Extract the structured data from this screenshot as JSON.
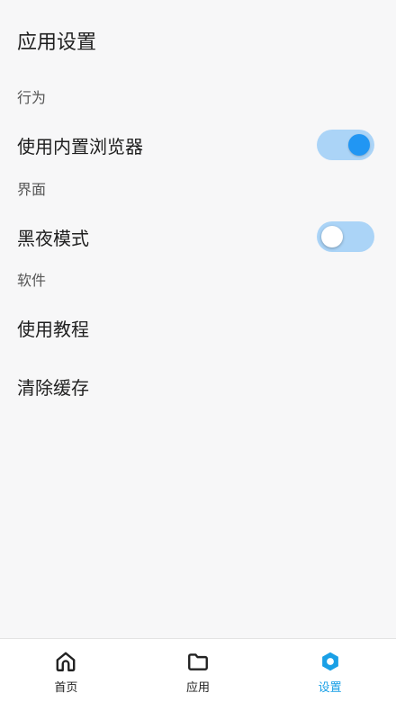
{
  "page": {
    "title": "应用设置"
  },
  "sections": [
    {
      "label": "行为",
      "items": [
        {
          "label": "使用内置浏览器",
          "control": "switch",
          "checked": true
        }
      ]
    },
    {
      "label": "界面",
      "items": [
        {
          "label": "黑夜模式",
          "control": "switch",
          "checked": false
        }
      ]
    },
    {
      "label": "软件",
      "items": [
        {
          "label": "使用教程"
        },
        {
          "label": "清除缓存"
        }
      ]
    }
  ],
  "bottom_nav": {
    "items": [
      {
        "label": "首页",
        "icon": "home-icon",
        "active": false
      },
      {
        "label": "应用",
        "icon": "folder-icon",
        "active": false
      },
      {
        "label": "设置",
        "icon": "gear-icon",
        "active": true
      }
    ]
  },
  "colors": {
    "accent": "#2196f3",
    "switch_track": "#abd4f7",
    "active_nav": "#1aa0e6",
    "background": "#f7f7f8"
  }
}
